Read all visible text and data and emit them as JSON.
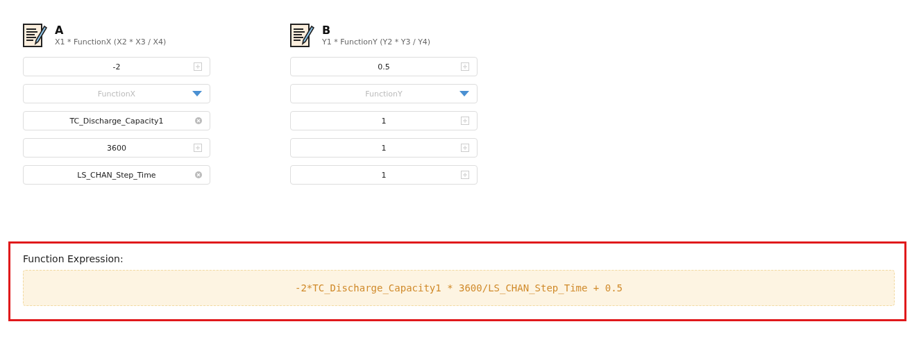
{
  "groups": [
    {
      "title": "A",
      "formula": "X1 * FunctionX (X2 * X3 / X4)",
      "fields": [
        {
          "kind": "number",
          "value": "-2"
        },
        {
          "kind": "select",
          "placeholder": "FunctionX"
        },
        {
          "kind": "variable",
          "value": "TC_Discharge_Capacity1"
        },
        {
          "kind": "number",
          "value": "3600"
        },
        {
          "kind": "variable",
          "value": "LS_CHAN_Step_Time"
        }
      ]
    },
    {
      "title": "B",
      "formula": "Y1 * FunctionY (Y2 * Y3 / Y4)",
      "fields": [
        {
          "kind": "number",
          "value": "0.5"
        },
        {
          "kind": "select",
          "placeholder": "FunctionY"
        },
        {
          "kind": "number",
          "value": "1"
        },
        {
          "kind": "number",
          "value": "1"
        },
        {
          "kind": "number",
          "value": "1"
        }
      ]
    }
  ],
  "expression": {
    "label": "Function Expression:",
    "value": "-2*TC_Discharge_Capacity1 * 3600/LS_CHAN_Step_Time + 0.5"
  }
}
